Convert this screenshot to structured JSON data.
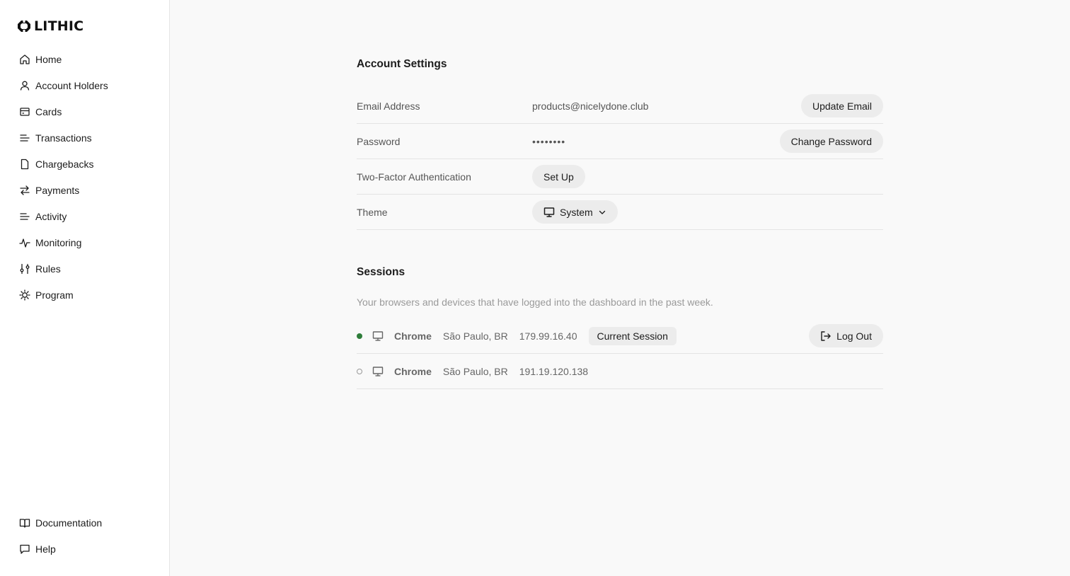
{
  "brand": {
    "name": "LITHIC"
  },
  "sidebar": {
    "items": [
      {
        "label": "Home",
        "icon": "home-icon"
      },
      {
        "label": "Account Holders",
        "icon": "user-icon"
      },
      {
        "label": "Cards",
        "icon": "card-icon"
      },
      {
        "label": "Transactions",
        "icon": "list-icon"
      },
      {
        "label": "Chargebacks",
        "icon": "document-icon"
      },
      {
        "label": "Payments",
        "icon": "arrows-exchange-icon"
      },
      {
        "label": "Activity",
        "icon": "list-icon"
      },
      {
        "label": "Monitoring",
        "icon": "pulse-icon"
      },
      {
        "label": "Rules",
        "icon": "sliders-icon"
      },
      {
        "label": "Program",
        "icon": "gear-icon"
      }
    ],
    "bottom_items": [
      {
        "label": "Documentation",
        "icon": "book-icon"
      },
      {
        "label": "Help",
        "icon": "chat-icon"
      }
    ]
  },
  "account_settings": {
    "title": "Account Settings",
    "email": {
      "label": "Email Address",
      "value": "products@nicelydone.club",
      "button": "Update Email"
    },
    "password": {
      "label": "Password",
      "value": "••••••••",
      "button": "Change Password"
    },
    "two_factor": {
      "label": "Two-Factor Authentication",
      "button": "Set Up"
    },
    "theme": {
      "label": "Theme",
      "value": "System",
      "icon": "monitor-icon"
    }
  },
  "sessions": {
    "title": "Sessions",
    "description": "Your browsers and devices that have logged into the dashboard in the past week.",
    "items": [
      {
        "status": "active",
        "browser": "Chrome",
        "location": "São Paulo, BR",
        "ip": "179.99.16.40",
        "tag": "Current Session",
        "action": "Log Out"
      },
      {
        "status": "inactive",
        "browser": "Chrome",
        "location": "São Paulo, BR",
        "ip": "191.19.120.138"
      }
    ]
  },
  "colors": {
    "active_status": "#2e7d3a",
    "button_bg": "#ececec",
    "page_bg": "#f9f9f9",
    "sidebar_bg": "#ffffff"
  }
}
